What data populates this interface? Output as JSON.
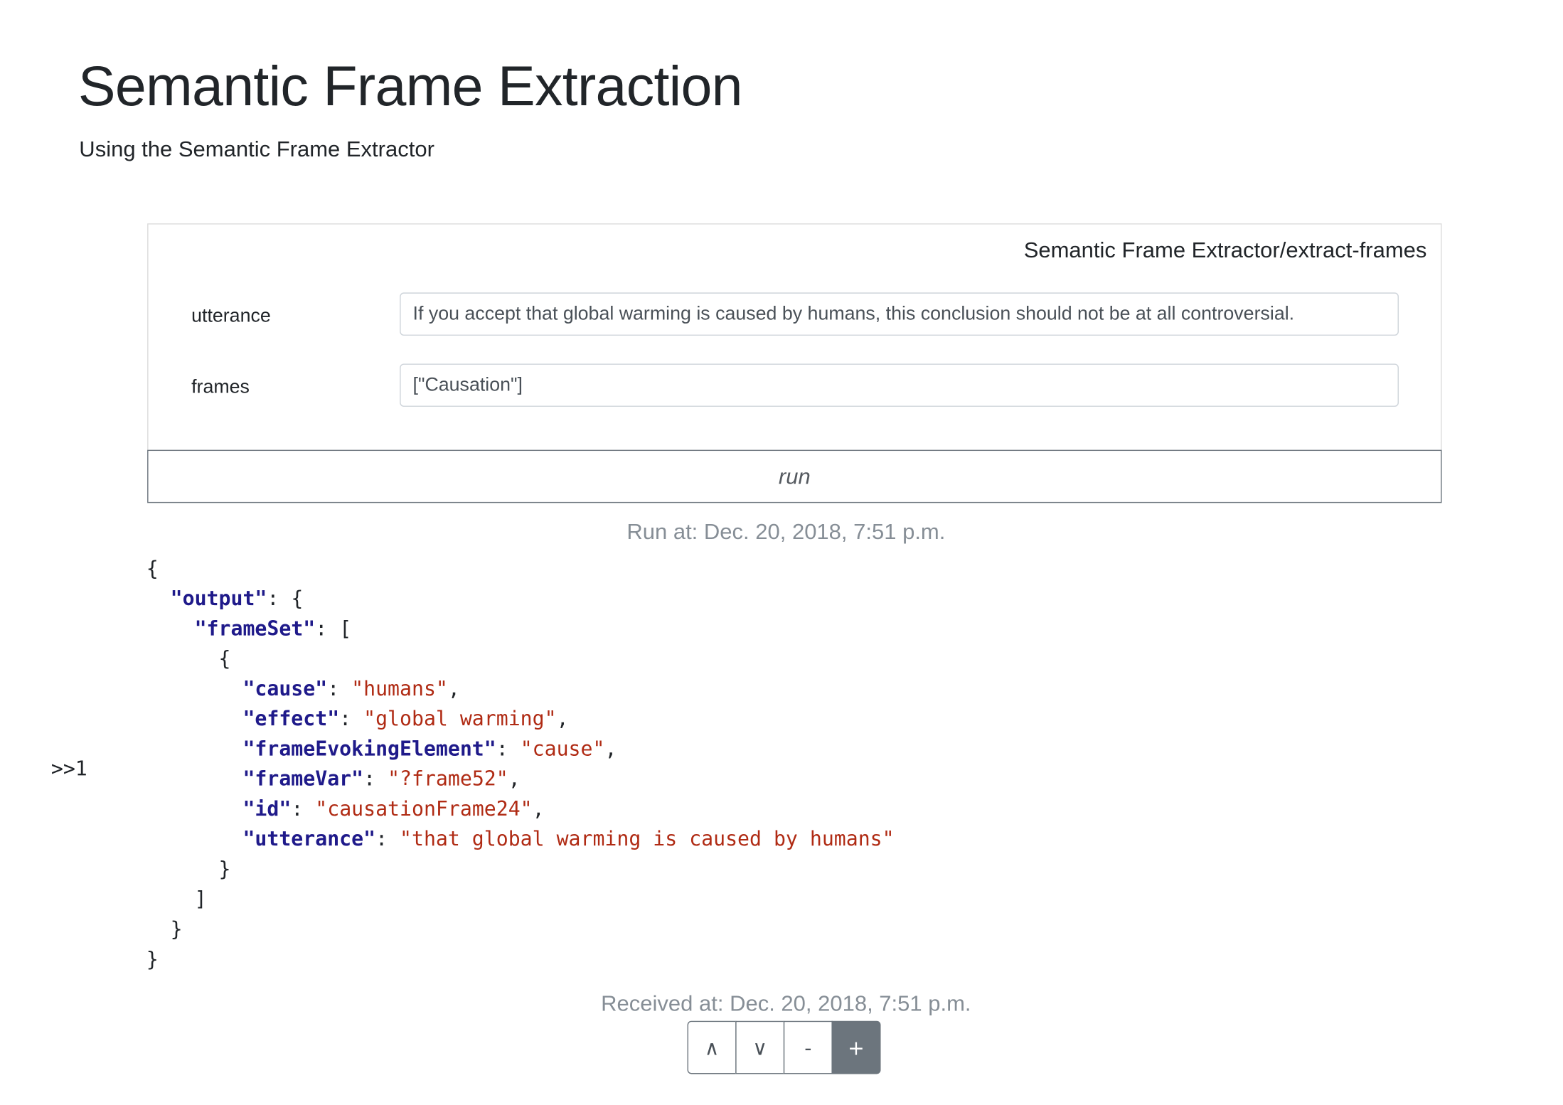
{
  "page": {
    "title": "Semantic Frame Extraction",
    "subtitle": "Using the Semantic Frame Extractor"
  },
  "card": {
    "endpoint": "Semantic Frame Extractor/extract-frames",
    "fields": [
      {
        "label": "utterance",
        "value": "If you accept that global warming is caused by humans, this conclusion should not be at all controversial."
      },
      {
        "label": "frames",
        "value": "[\"Causation\"]"
      }
    ],
    "run_label": "run"
  },
  "run_at": "Run at: Dec. 20, 2018, 7:51 p.m.",
  "output_marker": ">>1",
  "output_json": {
    "output": {
      "frameSet": [
        {
          "cause": "humans",
          "effect": "global warming",
          "frameEvokingElement": "cause",
          "frameVar": "?frame52",
          "id": "causationFrame24",
          "utterance": "that global warming is caused by humans"
        }
      ]
    }
  },
  "received_at": "Received at: Dec. 20, 2018, 7:51 p.m.",
  "controls": [
    {
      "icon": "chevron-up-icon",
      "glyph": "∧"
    },
    {
      "icon": "chevron-down-icon",
      "glyph": "∨"
    },
    {
      "icon": "minus-icon",
      "glyph": "-"
    },
    {
      "icon": "plus-icon",
      "glyph": "+"
    }
  ],
  "colors": {
    "json_key": "#1f1a8a",
    "json_string": "#b02b14",
    "secondary_text": "#868e96",
    "active_button": "#6c757d"
  }
}
